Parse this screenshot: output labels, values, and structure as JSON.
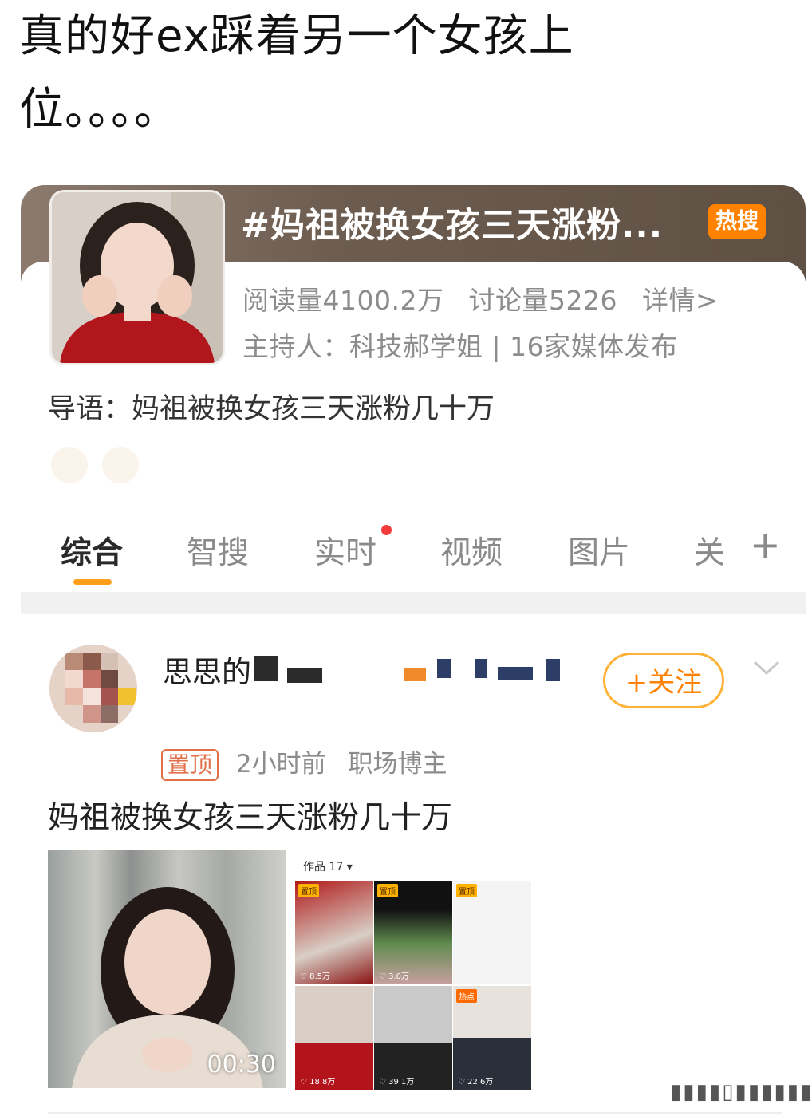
{
  "caption": {
    "line1": "真的好ex踩着另一个女孩上",
    "line2": "位。。。。"
  },
  "topic": {
    "title": "#妈祖被换女孩三天涨粉...",
    "hot_badge": "热搜",
    "reads": "阅读量4100.2万",
    "discussions": "讨论量5226",
    "details": "详情>",
    "host": "主持人：科技郝学姐 | 16家媒体发布",
    "guide": "导语：妈祖被换女孩三天涨粉几十万"
  },
  "tabs": {
    "items": [
      {
        "label": "综合"
      },
      {
        "label": "智搜"
      },
      {
        "label": "实时"
      },
      {
        "label": "视频"
      },
      {
        "label": "图片"
      },
      {
        "label": "关"
      }
    ],
    "plus": "+"
  },
  "post": {
    "username": "思思的",
    "follow_label": "+关注",
    "pin_label": "置顶",
    "time": "2小时前",
    "role": "职场博主",
    "text": "妈祖被换女孩三天涨粉几十万",
    "video_duration": "00:30",
    "grid_header": "作品 17 ▾",
    "grid_cells": [
      {
        "badge": "置顶",
        "likes": "♡ 8.5万"
      },
      {
        "badge": "置顶",
        "likes": "♡ 3.0万"
      },
      {
        "badge": "置顶",
        "likes": ""
      },
      {
        "badge": "",
        "likes": "♡ 18.8万"
      },
      {
        "badge": "",
        "likes": "♡ 39.1万"
      },
      {
        "badge": "热点",
        "likes": "♡ 22.6万"
      }
    ]
  },
  "colors": {
    "accent": "#ff8200",
    "hot_badge": "#ff8200",
    "tab_underline": "#ff9e1b",
    "red_dot": "#f33b3b"
  }
}
